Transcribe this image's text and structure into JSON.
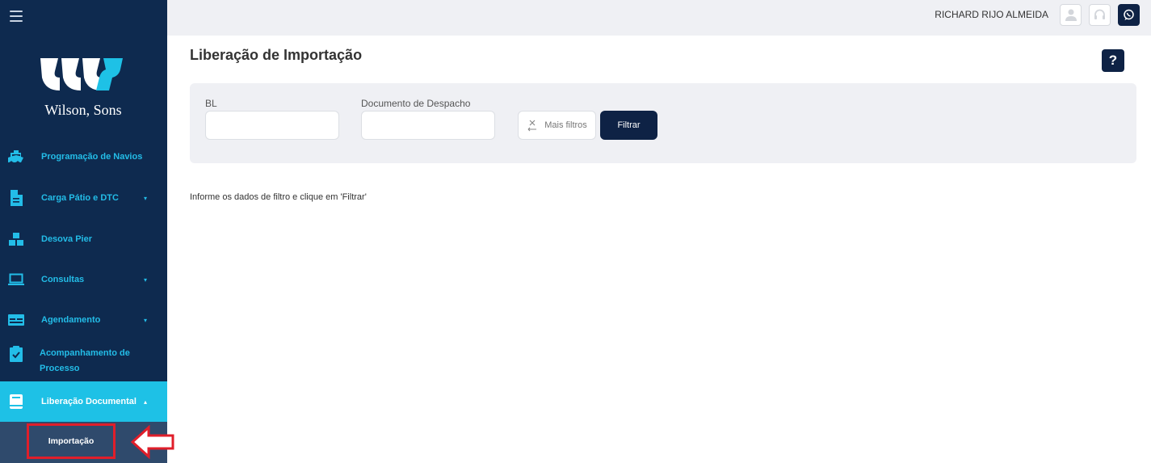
{
  "brand": {
    "name": "Wilson, Sons",
    "accent": "#1ec1e6",
    "navy": "#0e2a4f"
  },
  "sidebar": {
    "items": [
      {
        "label": "Programação de Navios",
        "icon": "ship-icon",
        "has_caret": false
      },
      {
        "label": "Carga Pátio e DTC",
        "icon": "document-icon",
        "has_caret": true
      },
      {
        "label": "Desova Pier",
        "icon": "boxes-icon",
        "has_caret": false
      },
      {
        "label": "Consultas",
        "icon": "laptop-icon",
        "has_caret": true
      },
      {
        "label": "Agendamento",
        "icon": "calendar-icon",
        "has_caret": true
      },
      {
        "label": "Acompanhamento de Processo",
        "icon": "clipboard-check-icon",
        "has_caret": false
      },
      {
        "label": "Liberação Documental",
        "icon": "book-icon",
        "has_caret": true,
        "active": true
      }
    ],
    "submenu": {
      "label": "Importação",
      "highlighted": true
    }
  },
  "topbar": {
    "user_name": "RICHARD RIJO ALMEIDA",
    "icons": [
      "user-icon",
      "headset-icon",
      "whatsapp-icon"
    ]
  },
  "page": {
    "title": "Liberação de Importação",
    "help_label": "?"
  },
  "filters": {
    "bl": {
      "label": "BL",
      "value": "",
      "placeholder": ""
    },
    "documento": {
      "label": "Documento de Despacho",
      "value": "",
      "placeholder": ""
    },
    "more_label": "Mais filtros",
    "submit_label": "Filtrar"
  },
  "info_message": "Informe os dados de filtro e clique em 'Filtrar'"
}
